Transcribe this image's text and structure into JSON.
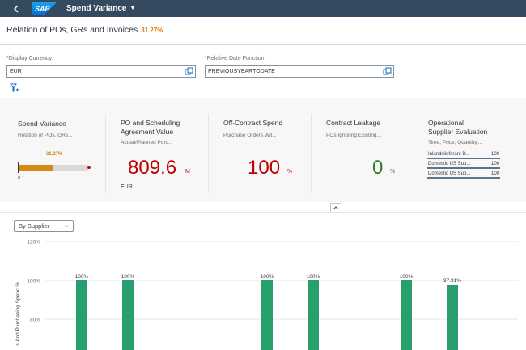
{
  "shell": {
    "app_title": "Spend Variance",
    "logo_text": "SAP"
  },
  "header": {
    "title": "Relation of POs, GRs and Invoices",
    "percent": "31.27%"
  },
  "filters": {
    "currency": {
      "label": "Display Currency:",
      "required_mark": "*",
      "value": "EUR"
    },
    "date_function": {
      "label": "Relative Date Function:",
      "required_mark": "*",
      "value": "PREVIOUSYEARTODATE"
    }
  },
  "kpis": {
    "spend_variance": {
      "title": "Spend Variance",
      "subtitle": "Relation of POs, GRs...",
      "bar_label": "31.27%",
      "bar_value": 0.3127,
      "min_label": "0.1"
    },
    "po_value": {
      "title_line1": "PO and Scheduling",
      "title_line2": "Agreement Value",
      "subtitle": "Actual/Planned Purc...",
      "value": "809.6",
      "unit": "M",
      "currency": "EUR"
    },
    "off_contract": {
      "title": "Off-Contract Spend",
      "subtitle": "Purchase Orders Wit...",
      "value": "100",
      "unit": "%"
    },
    "leakage": {
      "title": "Contract Leakage",
      "subtitle": "POs Ignoring Existing...",
      "value": "0",
      "unit": "%"
    },
    "supplier_eval": {
      "title_line1": "Operational",
      "title_line2": "Supplier Evaluation",
      "subtitle": "Time, Price, Quantity,...",
      "rows": [
        {
          "name": "Inlandslieferant D...",
          "value": "100"
        },
        {
          "name": "Domestic US Sup...",
          "value": "100"
        },
        {
          "name": "Domestic US Sup...",
          "value": "100"
        }
      ]
    }
  },
  "chart_area": {
    "select_value": "By Supplier"
  },
  "colors": {
    "shell": "#354a5f",
    "bar": "#28a06e",
    "critical": "#bb0000",
    "good": "#2b7d2b",
    "warning": "#e9730c"
  },
  "chart_data": {
    "type": "bar",
    "ylabel": "...s And Purchasing Spend %",
    "yticks": [
      "120%",
      "100%",
      "80%"
    ],
    "ylim": [
      60,
      120
    ],
    "values": [
      100,
      100,
      100,
      100,
      100,
      97.91
    ],
    "labels": [
      "100%",
      "100%",
      "100%",
      "100%",
      "100%",
      "97.91%"
    ],
    "grid": true
  }
}
